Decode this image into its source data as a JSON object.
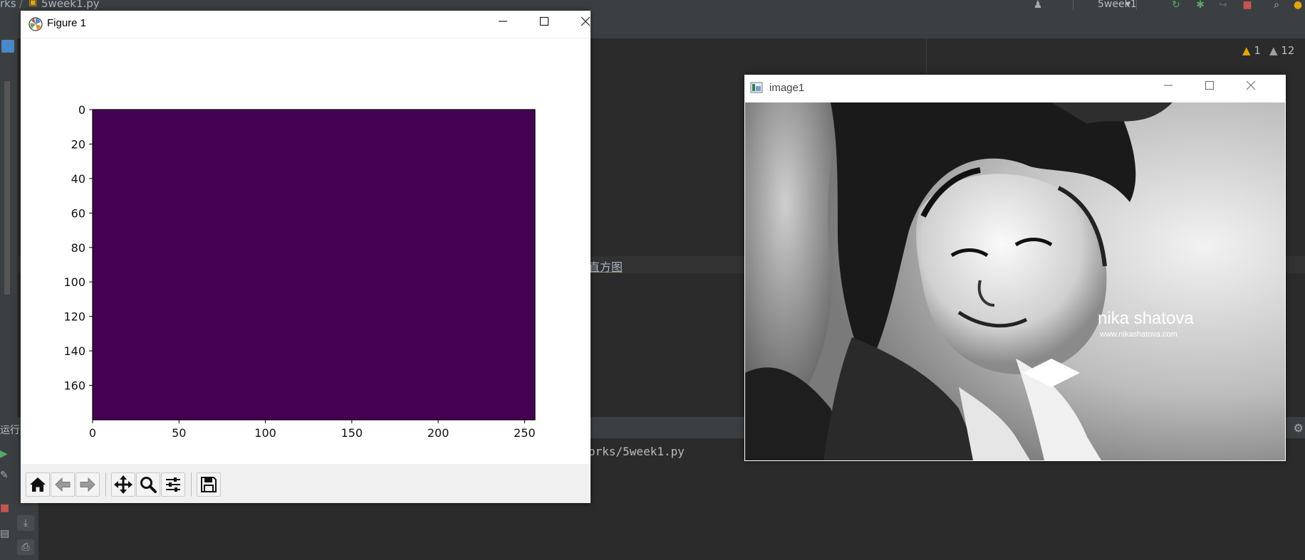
{
  "ide": {
    "breadcrumb_project": "rks",
    "breadcrumb_sep": "/",
    "breadcrumb_file": "5week1.py",
    "run_config": "5week1",
    "warnings_count": "1",
    "weak_warnings_count": "12",
    "editor_fragment": "直方图",
    "run_label": "运行:",
    "console_line": "orks/5week1.py"
  },
  "figure_window": {
    "title": "Figure 1",
    "toolbar": {
      "home": "home-icon",
      "back": "back-arrow-icon",
      "forward": "forward-arrow-icon",
      "pan": "pan-icon",
      "zoom": "zoom-icon",
      "configure": "configure-subplots-icon",
      "save": "save-icon"
    }
  },
  "image_window": {
    "title": "image1",
    "watermark_name": "nika shatova",
    "watermark_url": "www.nikashatova.com"
  },
  "chart_data": {
    "type": "heatmap",
    "title": "",
    "xlabel": "",
    "ylabel": "",
    "xlim": [
      0,
      256
    ],
    "ylim": [
      180,
      0
    ],
    "x_ticks": [
      0,
      50,
      100,
      150,
      200,
      250
    ],
    "y_ticks": [
      0,
      20,
      40,
      60,
      80,
      100,
      120,
      140,
      160
    ],
    "fill_color": "#440154",
    "colormap": "viridis",
    "grid": false,
    "legend": "none"
  }
}
